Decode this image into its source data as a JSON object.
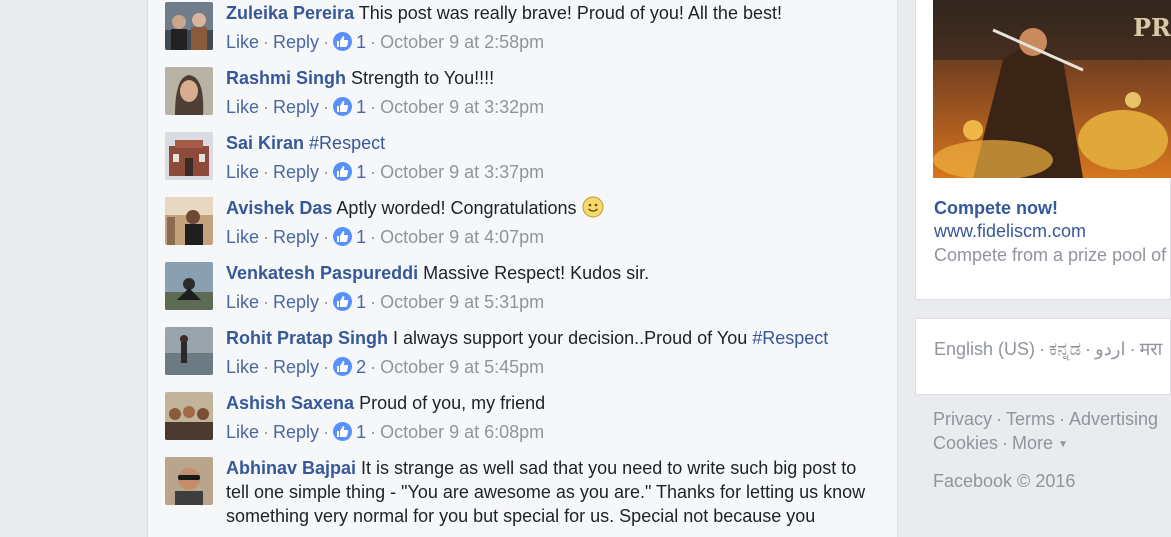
{
  "comments": [
    {
      "name": "Zuleika Pereira",
      "text": "This post was really brave! Proud of you! All the best!",
      "like": "Like",
      "reply": "Reply",
      "count": "1",
      "time": "October 9 at 2:58pm"
    },
    {
      "name": "Rashmi Singh",
      "text": "Strength to You!!!!",
      "like": "Like",
      "reply": "Reply",
      "count": "1",
      "time": "October 9 at 3:32pm"
    },
    {
      "name": "Sai Kiran",
      "text": "#Respect",
      "like": "Like",
      "reply": "Reply",
      "count": "1",
      "time": "October 9 at 3:37pm"
    },
    {
      "name": "Avishek Das",
      "text": "Aptly worded! Congratulations",
      "like": "Like",
      "reply": "Reply",
      "count": "1",
      "time": "October 9 at 4:07pm"
    },
    {
      "name": "Venkatesh Paspureddi",
      "text": "Massive Respect! Kudos sir.",
      "like": "Like",
      "reply": "Reply",
      "count": "1",
      "time": "October 9 at 5:31pm"
    },
    {
      "name": "Rohit Pratap Singh",
      "text": "I always support your decision..Proud of You",
      "hashtag": "#Respect",
      "like": "Like",
      "reply": "Reply",
      "count": "2",
      "time": "October 9 at 5:45pm"
    },
    {
      "name": "Ashish Saxena",
      "text": "Proud of you, my friend",
      "like": "Like",
      "reply": "Reply",
      "count": "1",
      "time": "October 9 at 6:08pm"
    },
    {
      "name": "Abhinav Bajpai",
      "text": "It is strange as well sad that you need to write such big post to tell one simple thing - \"You are awesome as you are.\" Thanks for letting us know something very normal for you but special for us. Special not because you"
    }
  ],
  "ad": {
    "image_text": "PRI",
    "title": "Compete now!",
    "url": "www.fideliscm.com",
    "description": "Compete from a prize pool of"
  },
  "languages": [
    "English (US)",
    "ಕನ್ನಡ",
    "اردو",
    "मरा"
  ],
  "footer": {
    "privacy": "Privacy",
    "terms": "Terms",
    "advertising": "Advertising",
    "cookies": "Cookies",
    "more": "More",
    "copyright": "Facebook © 2016"
  },
  "colors": {
    "link": "#365899",
    "muted": "#90949c",
    "like_badge": "#5890ff"
  }
}
